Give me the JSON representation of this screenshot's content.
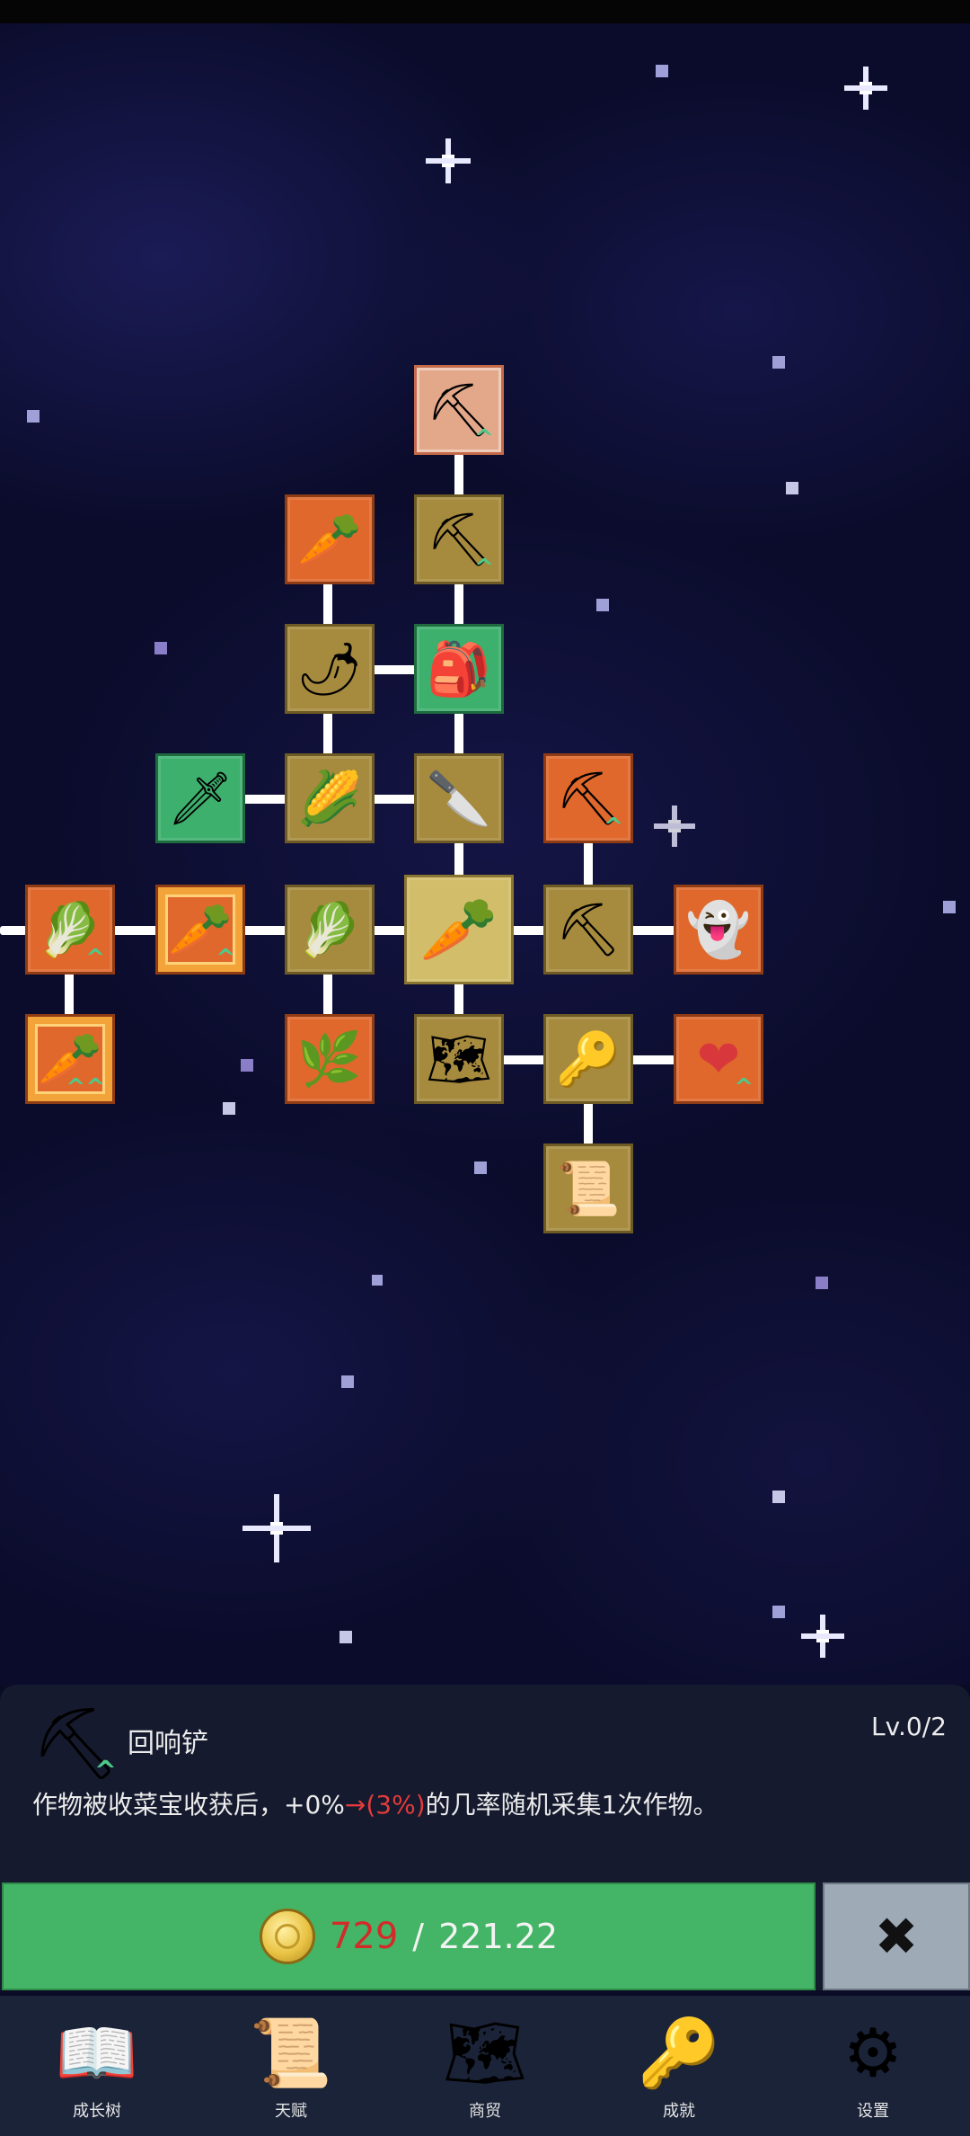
{
  "skill_tree": {
    "nodes": [
      {
        "id": "echo-shovel-top",
        "icon": "shovel-icon",
        "glyph": "⛏",
        "bg": "glow",
        "chevrons": "^"
      },
      {
        "id": "radish",
        "icon": "radish-icon",
        "glyph": "🥕",
        "bg": "orange"
      },
      {
        "id": "shovel",
        "icon": "shovel-icon",
        "glyph": "⛏",
        "bg": "gold",
        "chevrons": "^"
      },
      {
        "id": "chili",
        "icon": "chili-icon",
        "glyph": "🌶",
        "bg": "gold"
      },
      {
        "id": "backpack",
        "icon": "backpack-icon",
        "glyph": "🎒",
        "bg": "green"
      },
      {
        "id": "sword",
        "icon": "sword-icon",
        "glyph": "🗡",
        "bg": "green"
      },
      {
        "id": "corn",
        "icon": "corn-icon",
        "glyph": "🌽",
        "bg": "gold"
      },
      {
        "id": "knife",
        "icon": "knife-icon",
        "glyph": "🔪",
        "bg": "gold"
      },
      {
        "id": "pickaxe-top",
        "icon": "pickaxe-icon",
        "glyph": "⛏",
        "bg": "orange",
        "chevrons": "^"
      },
      {
        "id": "cabbage-left",
        "icon": "cabbage-icon",
        "glyph": "🥬",
        "bg": "orange",
        "chevrons": "^"
      },
      {
        "id": "carrot-framed",
        "icon": "carrot-icon",
        "glyph": "🥕",
        "bg": "orange",
        "chevrons": "^"
      },
      {
        "id": "cabbage",
        "icon": "cabbage-icon",
        "glyph": "🥬",
        "bg": "gold"
      },
      {
        "id": "carrot-center",
        "icon": "carrot-icon",
        "glyph": "🥕",
        "bg": "center"
      },
      {
        "id": "pickaxe",
        "icon": "pickaxe-icon",
        "glyph": "⛏",
        "bg": "gold"
      },
      {
        "id": "ghost",
        "icon": "ghost-icon",
        "glyph": "👻",
        "bg": "orange"
      },
      {
        "id": "carrot-framed-2",
        "icon": "carrot-icon",
        "glyph": "🥕",
        "bg": "orange",
        "chevrons": "^^"
      },
      {
        "id": "leek",
        "icon": "leek-icon",
        "glyph": "🌿",
        "bg": "orange"
      },
      {
        "id": "map",
        "icon": "map-icon",
        "glyph": "🗺",
        "bg": "gold"
      },
      {
        "id": "key",
        "icon": "key-icon",
        "glyph": "🔑",
        "bg": "gold"
      },
      {
        "id": "heart",
        "icon": "heart-icon",
        "glyph": "❤",
        "bg": "orange",
        "chevrons": "^"
      },
      {
        "id": "scroll",
        "icon": "scroll-icon",
        "glyph": "📜",
        "bg": "gold"
      }
    ]
  },
  "detail": {
    "icon": "shovel-icon",
    "icon_glyph": "⛏",
    "name": "回响铲",
    "level": "Lv.0/2",
    "desc_before": "作物被收菜宝收获后，+0%",
    "desc_arrow": "→(3%)",
    "desc_after": "的几率随机采集1次作物。"
  },
  "upgrade": {
    "have": "729",
    "separator": "/",
    "need": "221.22",
    "coin_icon": "coin-icon"
  },
  "close": {
    "glyph": "✖",
    "icon": "close-icon"
  },
  "nav": [
    {
      "label": "成长树",
      "icon": "book-icon",
      "glyph": "📖"
    },
    {
      "label": "天赋",
      "icon": "scroll-icon",
      "glyph": "📜"
    },
    {
      "label": "商贸",
      "icon": "map-icon",
      "glyph": "🗺"
    },
    {
      "label": "成就",
      "icon": "key-icon",
      "glyph": "🔑"
    },
    {
      "label": "设置",
      "icon": "gear-icon",
      "glyph": "⚙"
    }
  ],
  "colors": {
    "bg_sky": "#0b0c2c",
    "panel": "#151a2e",
    "upgrade_green": "#44b566",
    "close_gray": "#9eaab6",
    "highlight_red": "#e23b3b"
  }
}
